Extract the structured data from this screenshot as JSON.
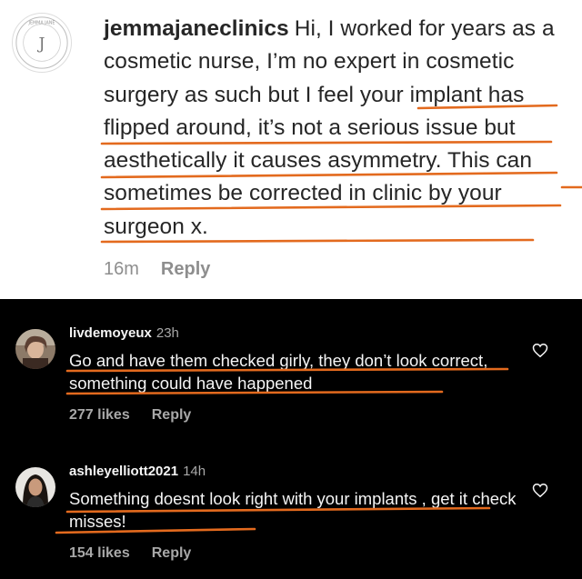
{
  "top_comment": {
    "username": "jemmajaneclinics",
    "text": "Hi, I worked for years as a cosmetic nurse, I’m no expert in cosmetic surgery as such but I feel your implant has flipped around, it’s not a serious issue but aesthetically it causes asymmetry. This can sometimes be corrected in clinic by your surgeon x.",
    "time": "16m",
    "reply_label": "Reply",
    "avatar_logo_letter": "J",
    "avatar_logo_ring_text": "JEMMA JANE"
  },
  "comments": [
    {
      "username": "livdemoyeux",
      "time": "23h",
      "text": "Go and have them checked girly, they don’t look correct, something could have happened",
      "likes": "277 likes",
      "reply_label": "Reply",
      "avatar_icon": "profile-photo-avatar"
    },
    {
      "username": "ashleyelliott2021",
      "time": "14h",
      "text": "Something doesnt look right with your implants , get it check misses!",
      "likes": "154 likes",
      "reply_label": "Reply",
      "avatar_icon": "profile-photo-avatar"
    }
  ],
  "colors": {
    "underline": "#e36a1e",
    "text_dark": "#262626",
    "meta_gray": "#8e8e8e",
    "bg_dark": "#000000",
    "text_light": "#f5f5f5"
  },
  "icons": [
    "heart-icon",
    "heart-icon"
  ]
}
